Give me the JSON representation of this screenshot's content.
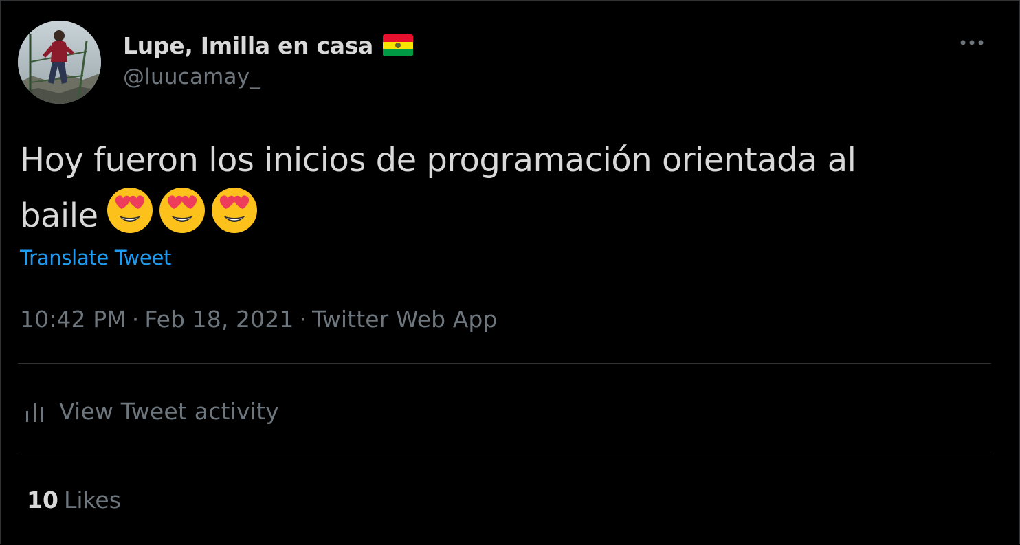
{
  "author": {
    "display_name": "Lupe, Imilla en casa",
    "flag_icon": "bolivia-flag-icon",
    "handle": "@luucamay_"
  },
  "tweet": {
    "text_line1": "Hoy fueron los inicios de programación orientada al",
    "text_line2": "baile",
    "emojis": [
      "smiling-face-with-heart-eyes-icon",
      "smiling-face-with-heart-eyes-icon",
      "smiling-face-with-heart-eyes-icon"
    ],
    "translate_label": "Translate Tweet"
  },
  "meta": {
    "time": "10:42 PM",
    "separator": "·",
    "date": "Feb 18, 2021",
    "source": "Twitter Web App"
  },
  "activity": {
    "label": "View Tweet activity",
    "icon": "bar-chart-icon"
  },
  "engagement": {
    "likes_count": "10",
    "likes_label": "Likes"
  },
  "colors": {
    "background": "#000000",
    "text_primary": "#d9d9d9",
    "text_secondary": "#6e767d",
    "link": "#1d9bf0",
    "divider": "#2f3336"
  }
}
